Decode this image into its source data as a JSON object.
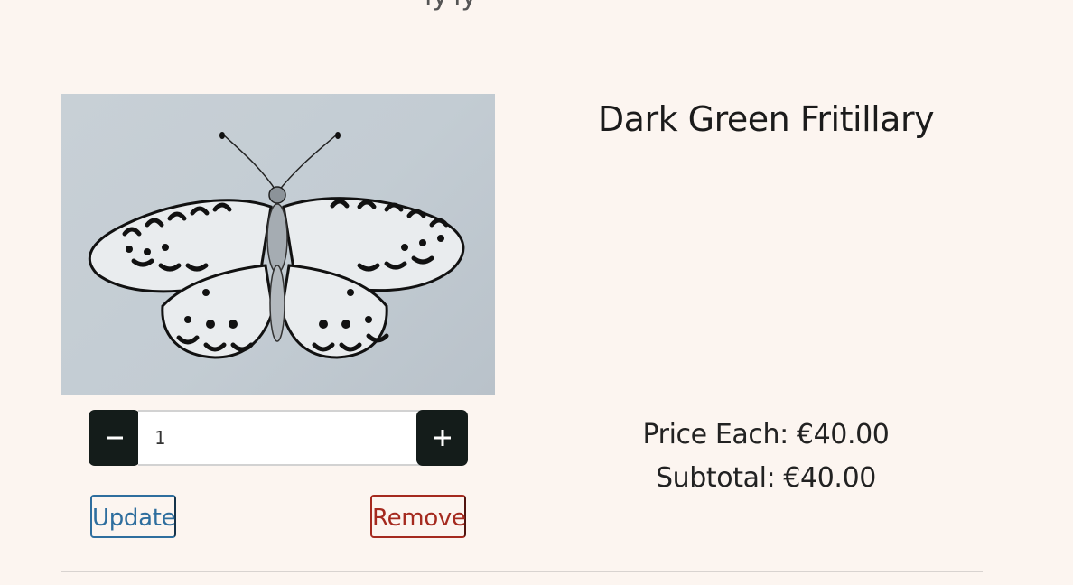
{
  "header_fragment": "ly ly",
  "product": {
    "title": "Dark Green Fritillary",
    "image_icon": "butterfly-drawing",
    "price_label": "Price Each: €40.00",
    "subtotal_label": "Subtotal: €40.00"
  },
  "quantity": {
    "value": "1",
    "decrement_icon": "minus-icon",
    "increment_icon": "plus-icon"
  },
  "actions": {
    "update_label": "Update",
    "remove_label": "Remove"
  },
  "colors": {
    "background": "#fcf5f0",
    "button_dark": "#141c1a",
    "update": "#2e6e9e",
    "remove": "#a52a1f"
  }
}
